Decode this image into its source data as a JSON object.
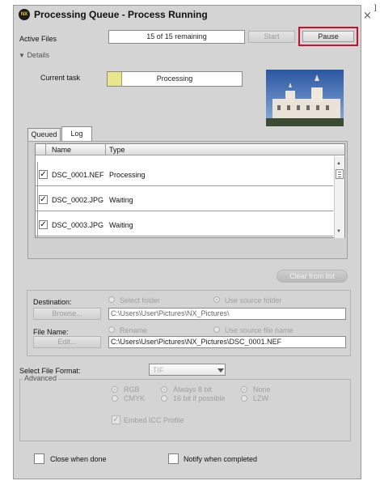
{
  "window": {
    "title": "Processing Queue - Process Running",
    "logo_text": "NX",
    "close_glyph": "×",
    "edge_glyph": "]"
  },
  "status": {
    "active_files_label": "Active Files",
    "remaining": "15 of 15 remaining",
    "start_label": "Start",
    "pause_label": "Pause"
  },
  "details": {
    "toggle_label": "Details",
    "current_task_label": "Current task",
    "task_status": "Processing",
    "progress_fraction": 0.11
  },
  "tabs": [
    {
      "label": "Queued"
    },
    {
      "label": "Log"
    }
  ],
  "queue": {
    "columns": [
      "Name",
      "Type"
    ],
    "rows": [
      {
        "checked": true,
        "name": "DSC_0001.NEF",
        "type": "Processing"
      },
      {
        "checked": true,
        "name": "DSC_0002.JPG",
        "type": "Waiting"
      },
      {
        "checked": true,
        "name": "DSC_0003.JPG",
        "type": "Waiting"
      }
    ],
    "clear_label": "Clear from list"
  },
  "destination": {
    "label": "Destination:",
    "browse_label": "Browse...",
    "select_folder_label": "Select folder",
    "use_source_label": "Use source folder",
    "path": "C:\\Users\\User\\Pictures\\NX_Pictures\\"
  },
  "file_name": {
    "label": "File Name:",
    "edit_label": "Edit...",
    "rename_label": "Rename",
    "use_source_name_label": "Use source file name",
    "path": "C:\\Users\\User\\Pictures\\NX_Pictures\\DSC_0001.NEF"
  },
  "format": {
    "label": "Select File Format:",
    "value": "TIF",
    "advanced_label": "Advanced",
    "rgb": "RGB",
    "cmyk": "CMYK",
    "always8": "Always 8 bit",
    "bit16": "16 bit if possible",
    "none": "None",
    "lzw": "LZW",
    "embed_icc": "Embed ICC Profile"
  },
  "footer": {
    "close_when_done": "Close when done",
    "notify": "Notify when completed"
  },
  "colors": {
    "highlight": "#c8102e",
    "progress_fill": "#e9e58a"
  }
}
